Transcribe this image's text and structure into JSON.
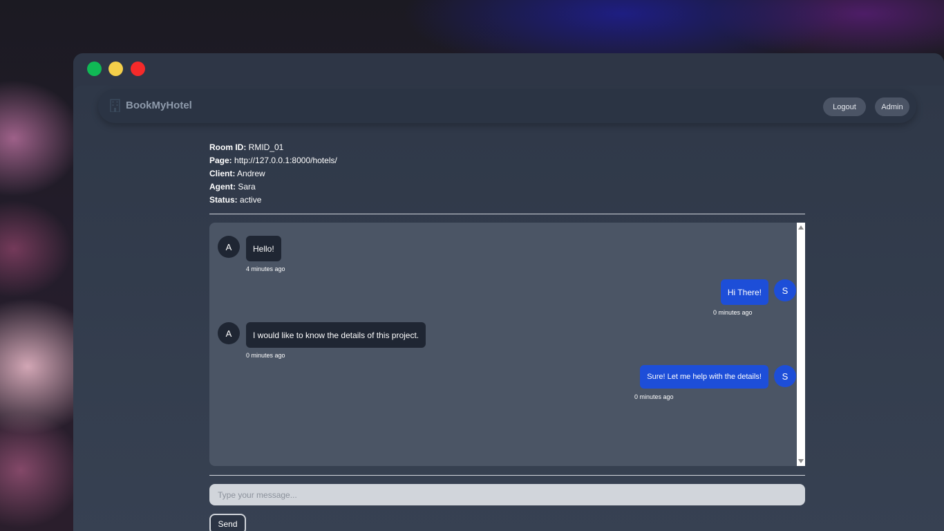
{
  "app": {
    "brand": "BookMyHotel"
  },
  "navbar": {
    "logout_label": "Logout",
    "admin_label": "Admin"
  },
  "room_info": {
    "room_id_label": "Room ID:",
    "room_id": "RMID_01",
    "page_label": "Page:",
    "page": "http://127.0.0.1:8000/hotels/",
    "client_label": "Client:",
    "client": "Andrew",
    "agent_label": "Agent:",
    "agent": "Sara",
    "status_label": "Status:",
    "status": "active"
  },
  "messages": [
    {
      "sender": "client",
      "initial": "A",
      "text": "Hello!",
      "time": "4 minutes ago"
    },
    {
      "sender": "agent",
      "initial": "S",
      "text": "Hi There!",
      "time": "0 minutes ago"
    },
    {
      "sender": "client",
      "initial": "A",
      "text": "I would like to know the details of this project.",
      "time": "0 minutes ago"
    },
    {
      "sender": "agent",
      "initial": "S",
      "text": "Sure! Let me help with the details!",
      "time": "0 minutes ago"
    }
  ],
  "composer": {
    "placeholder": "Type your message...",
    "send_label": "Send"
  },
  "colors": {
    "agent_bubble": "#1d4ed8",
    "client_bubble": "#1f2633",
    "chat_bg": "#4b5565"
  },
  "icons": {
    "brand": "hotel-building-icon"
  }
}
